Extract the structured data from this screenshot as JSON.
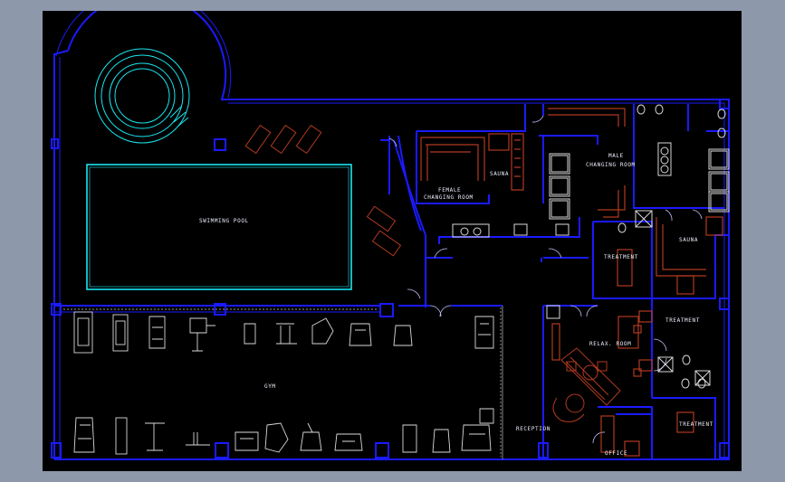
{
  "viewport": {
    "background": "#8d98ab",
    "canvas_background": "#000000"
  },
  "colors": {
    "walls": "#1a1aff",
    "pool": "#19e6f0",
    "furniture": "#b03a20",
    "equipment": "#d8d8d8",
    "labels": "#eef0ff"
  },
  "rooms": {
    "swimming_pool": "SWIMMING POOL",
    "gym": "GYM",
    "female_changing_1": "FEMALE",
    "female_changing_2": "CHANGING ROOM",
    "sauna_female": "SAUNA",
    "male_changing_1": "MALE",
    "male_changing_2": "CHANGING ROOM",
    "sauna_male": "SAUNA",
    "treatment_1": "TREATMENT",
    "treatment_2": "TREATMENT",
    "treatment_3": "TREATMENT",
    "relax_room": "RELAX. ROOM",
    "reception": "RECEPTION",
    "office": "OFFICE"
  }
}
